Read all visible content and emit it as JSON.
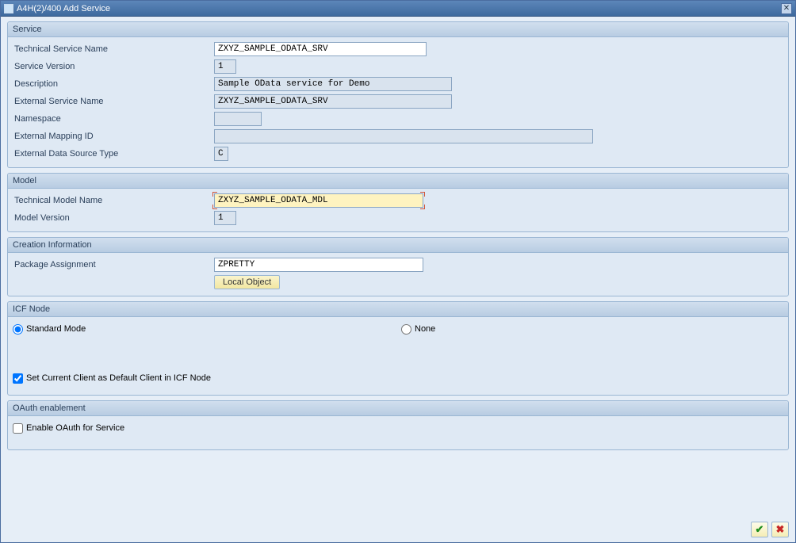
{
  "window": {
    "title": "A4H(2)/400 Add Service"
  },
  "service": {
    "header": "Service",
    "tech_name_label": "Technical Service Name",
    "tech_name_value": "ZXYZ_SAMPLE_ODATA_SRV",
    "version_label": "Service Version",
    "version_value": "1",
    "desc_label": "Description",
    "desc_value": "Sample OData service for Demo",
    "ext_name_label": "External Service Name",
    "ext_name_value": "ZXYZ_SAMPLE_ODATA_SRV",
    "namespace_label": "Namespace",
    "namespace_value": "",
    "ext_map_label": "External Mapping ID",
    "ext_map_value": "",
    "ext_ds_label": "External Data Source Type",
    "ext_ds_value": "C"
  },
  "model": {
    "header": "Model",
    "tech_name_label": "Technical Model Name",
    "tech_name_value": "ZXYZ_SAMPLE_ODATA_MDL",
    "version_label": "Model Version",
    "version_value": "1"
  },
  "creation": {
    "header": "Creation Information",
    "pkg_label": "Package Assignment",
    "pkg_value": "ZPRETTY",
    "local_btn": "Local Object"
  },
  "icf": {
    "header": "ICF Node",
    "standard_label": "Standard Mode",
    "none_label": "None",
    "default_client_label": "Set Current Client as Default Client in ICF Node"
  },
  "oauth": {
    "header": "OAuth enablement",
    "enable_label": "Enable OAuth for Service"
  }
}
